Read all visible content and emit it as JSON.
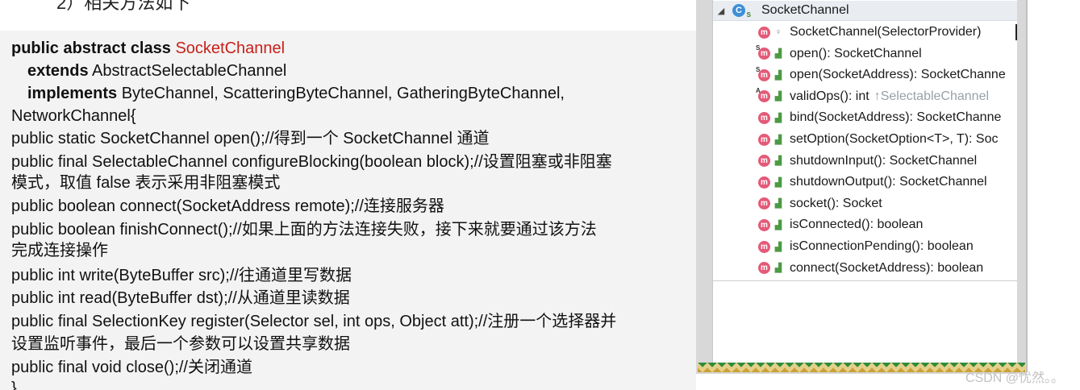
{
  "slide": {
    "heading": "2）相关方法如下",
    "code": {
      "l1_kw": "public abstract class",
      "l1_name": "SocketChannel",
      "l2_kw": "extends",
      "l2_rest": "AbstractSelectableChannel",
      "l3_kw": "implements",
      "l3_rest": "ByteChannel, ScatteringByteChannel, GatheringByteChannel,",
      "l4": "NetworkChannel{",
      "l5": "public static SocketChannel open();//得到一个 SocketChannel 通道",
      "l6": "public final SelectableChannel configureBlocking(boolean block);//设置阻塞或非阻塞",
      "l7": "模式，取值 false 表示采用非阻塞模式",
      "l8": "public boolean connect(SocketAddress remote);//连接服务器",
      "l9": "public boolean finishConnect();//如果上面的方法连接失败，接下来就要通过该方法",
      "l10": "完成连接操作",
      "l11": "public int write(ByteBuffer src);//往通道里写数据",
      "l12": "public int read(ByteBuffer dst);//从通道里读数据",
      "l13": "public final SelectionKey register(Selector sel, int ops, Object att);//注册一个选择器并",
      "l14": "设置监听事件，最后一个参数可以设置共享数据",
      "l15": "public final void close();//关闭通道",
      "l16": "}"
    }
  },
  "ide": {
    "root": {
      "label": "SocketChannel",
      "icon": "class-icon"
    },
    "methods": [
      {
        "label": "SocketChannel(SelectorProvider)",
        "hint": "",
        "icon": "method-icon"
      },
      {
        "label": "open(): SocketChannel",
        "hint": "",
        "icon": "method-icon"
      },
      {
        "label": "open(SocketAddress): SocketChanne",
        "hint": "",
        "icon": "method-icon"
      },
      {
        "label": "validOps(): int",
        "hint": "↑SelectableChannel",
        "icon": "method-icon"
      },
      {
        "label": "bind(SocketAddress): SocketChanne",
        "hint": "",
        "icon": "method-icon"
      },
      {
        "label": "setOption(SocketOption<T>, T): Soc",
        "hint": "",
        "icon": "method-icon"
      },
      {
        "label": "shutdownInput(): SocketChannel",
        "hint": "",
        "icon": "method-icon"
      },
      {
        "label": "shutdownOutput(): SocketChannel",
        "hint": "",
        "icon": "method-icon"
      },
      {
        "label": "socket(): Socket",
        "hint": "",
        "icon": "method-icon"
      },
      {
        "label": "isConnected(): boolean",
        "hint": "",
        "icon": "method-icon"
      },
      {
        "label": "isConnectionPending(): boolean",
        "hint": "",
        "icon": "method-icon"
      },
      {
        "label": "connect(SocketAddress): boolean",
        "hint": "",
        "icon": "method-icon"
      }
    ]
  },
  "watermark": "CSDN @忧然。。",
  "colors": {
    "class_name": "#c8201a",
    "method_icon": "#e45a78",
    "class_icon": "#3d8fd6"
  }
}
